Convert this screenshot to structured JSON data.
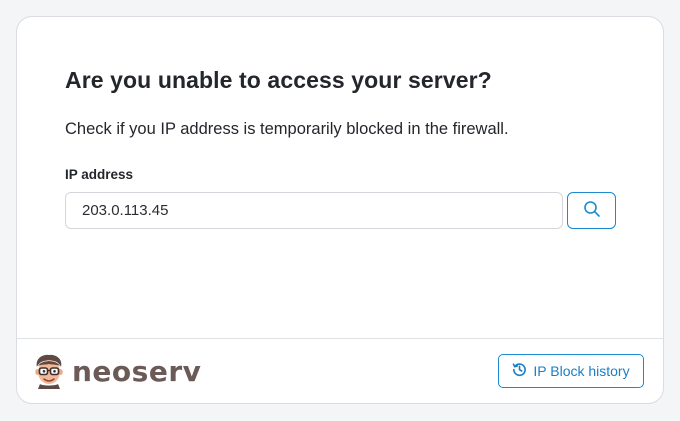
{
  "heading": "Are you unable to access your server?",
  "description": "Check if you IP address is temporarily blocked in the firewall.",
  "ip_field": {
    "label": "IP address",
    "value": "203.0.113.45"
  },
  "search_button": {
    "icon": "search-icon"
  },
  "footer": {
    "brand": "neoserv",
    "history_button": {
      "label": "IP Block history",
      "icon": "history-icon"
    }
  },
  "colors": {
    "accent": "#1a8bd1",
    "brand": "#6b5a56",
    "text": "#23262b"
  }
}
